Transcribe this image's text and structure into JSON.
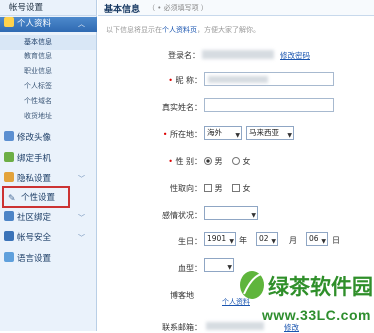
{
  "sidebar": {
    "top_title": "帐号设置",
    "sections": [
      {
        "label": "个人资料",
        "active": true,
        "icon": "profile-icon"
      },
      {
        "label": "修改头像",
        "icon": "avatar-icon"
      },
      {
        "label": "绑定手机",
        "icon": "phone-icon"
      },
      {
        "label": "隐私设置",
        "icon": "privacy-icon"
      },
      {
        "label": "个性设置",
        "icon": "wrench-icon"
      },
      {
        "label": "社区绑定",
        "icon": "community-icon"
      },
      {
        "label": "帐号安全",
        "icon": "security-icon"
      },
      {
        "label": "语言设置",
        "icon": "language-icon"
      }
    ],
    "sub_items": [
      "基本信息",
      "教育信息",
      "职业信息",
      "个人标签",
      "个性域名",
      "收货地址"
    ],
    "highlight_color": "#cc3333"
  },
  "main": {
    "header": {
      "title": "基本信息",
      "required_note": "（ • 必须填写项 ）"
    },
    "info_line": {
      "prefix": "以下信息将显示在",
      "link": "个人资料页",
      "suffix": "，方便大家了解你。"
    },
    "fields": {
      "login_label": "登录名：",
      "change_password": "修改密码",
      "nickname_label": "昵  称：",
      "realname_label": "真实姓名：",
      "location_label": "所在地：",
      "location_country": "海外",
      "location_region": "马来西亚",
      "gender_label": "性  别：",
      "gender_male": "男",
      "gender_female": "女",
      "orientation_label": "性取向：",
      "orientation_male": "男",
      "orientation_female": "女",
      "relationship_label": "感情状况：",
      "relationship_value": "",
      "birthday_label": "生日：",
      "birth_year": "1901",
      "year_unit": "年",
      "birth_month": "02",
      "month_unit": "月",
      "birth_day": "06",
      "day_unit": "日",
      "blood_label": "血型：",
      "blood_value": "",
      "blog_label": "博客地",
      "blog_link": "个人资料",
      "contact_label": "联系邮箱：",
      "contact_link": "修改"
    }
  },
  "watermark": {
    "logo_text": "绿茶软件园",
    "site": "www.33LC.com"
  }
}
